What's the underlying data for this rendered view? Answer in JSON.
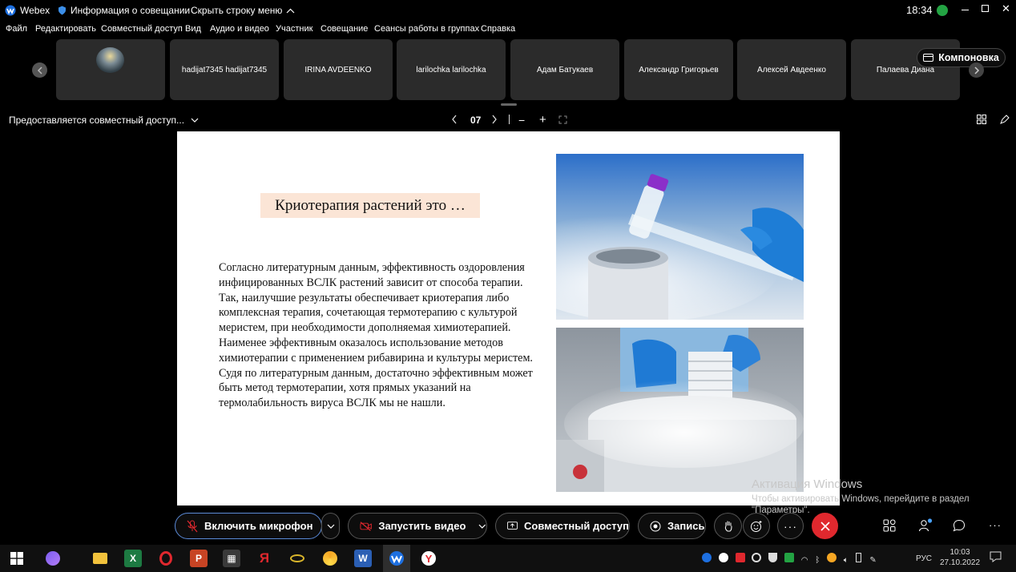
{
  "titlebar": {
    "app_name": "Webex",
    "meeting_info": "Информация о совещании",
    "hide_menu": "Скрыть строку меню",
    "time": "18:34"
  },
  "menu": [
    "Файл",
    "Редактировать",
    "Совместный доступ",
    "Вид",
    "Аудио и видео",
    "Участник",
    "Совещание",
    "Сеансы работы в группах",
    "Справка"
  ],
  "participants": [
    "hadijat7345 hadijat7345",
    "IRINA AVDEENKO",
    "larilochka larilochka",
    "Адам Батукаев",
    "Александр Григорьев",
    "Алексей Авдеенко",
    "Палаева Диана"
  ],
  "layout_button": "Компоновка",
  "share": {
    "label": "Предоставляется совместный доступ...",
    "page": "07"
  },
  "slide": {
    "title": "Криотерапия растений это …",
    "body": "Согласно литературным данным, эффективность оздоровления инфицированных ВСЛК растений зависит от способа терапии. Так, наилучшие результаты  обеспечивает криотерапия либо комплексная терапия, сочетающая термотерапию с культурой меристем, при необходимости дополняемая химиотерапией. Наименее эффективным оказалось использование методов химиотерапии с применением рибавирина и культуры меристем. Судя по литературным данным, достаточно эффективным может быть метод термотерапии, хотя прямых указаний на термолабильность вируса ВСЛК мы не нашли."
  },
  "watermark": {
    "title": "Активация Windows",
    "line1": "Чтобы активировать Windows, перейдите в раздел",
    "line2": "\"Параметры\"."
  },
  "controls": {
    "mic": "Включить микрофон",
    "video": "Запустить видео",
    "share": "Совместный доступ",
    "record": "Запись"
  },
  "taskbar": {
    "lang": "РУС",
    "time": "10:03",
    "date": "27.10.2022"
  },
  "colors": {
    "end_call": "#e0282e",
    "slide_title_bg": "#fbe5d6",
    "accent_green": "#23a343"
  }
}
